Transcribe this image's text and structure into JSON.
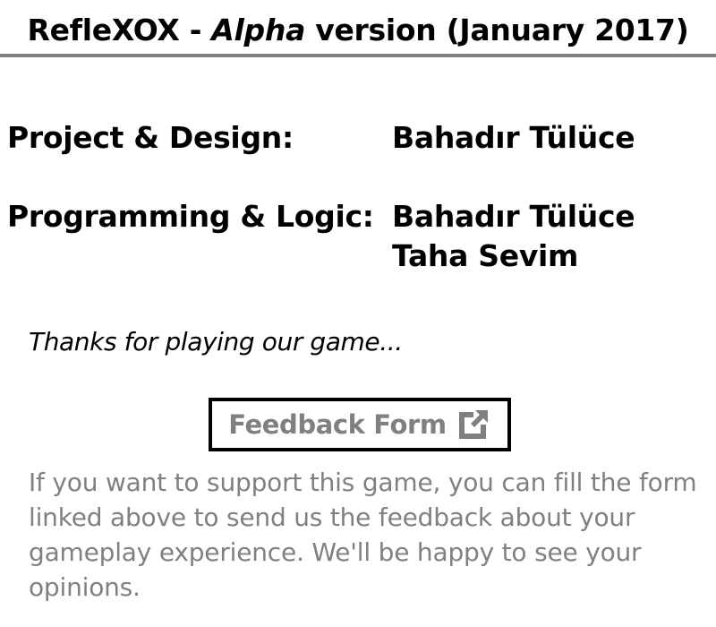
{
  "header": {
    "title_pre": "RefleXOX - ",
    "title_italic": "Alpha",
    "title_post": " version (January 2017)"
  },
  "credits": [
    {
      "role": "Project & Design:",
      "names": [
        "Bahadır Tülüce"
      ]
    },
    {
      "role": "Programming & Logic:",
      "names": [
        "Bahadır Tülüce",
        "Taha Sevim"
      ]
    }
  ],
  "thanks_text": "Thanks for playing our game...",
  "feedback": {
    "label": "Feedback Form",
    "icon": "external-link-icon"
  },
  "support_text": "If you want to support this game, you can fill the form linked above to send us the feedback about your gameplay experience. We'll be happy to see your opinions.",
  "colors": {
    "text": "#000000",
    "muted": "#808080",
    "divider": "#808080",
    "background": "#ffffff"
  }
}
